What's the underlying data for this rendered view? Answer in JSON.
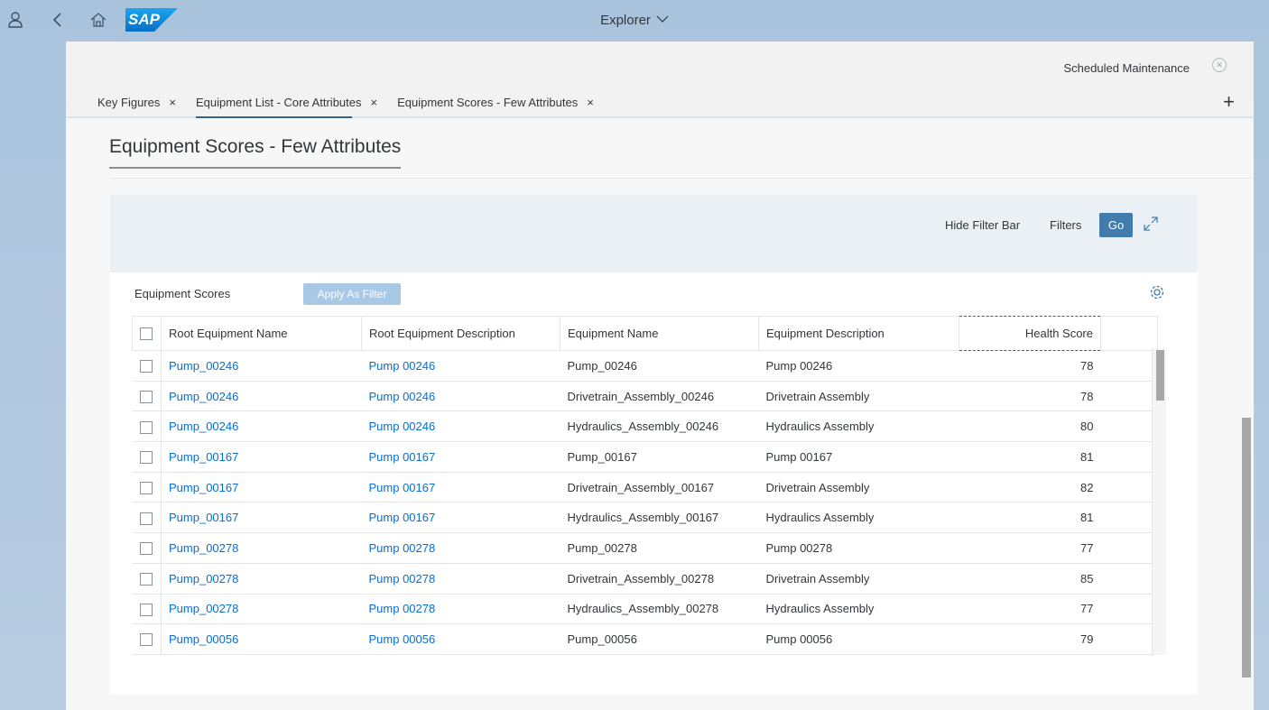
{
  "shell": {
    "title": "Explorer",
    "logo_text": "SAP"
  },
  "app_header": {
    "scheduled_link": "Scheduled Maintenance",
    "tabs": [
      {
        "label": "Key Figures",
        "close": "×"
      },
      {
        "label": "Equipment List - Core Attributes",
        "close": "×"
      },
      {
        "label": "Equipment Scores - Few Attributes",
        "close": "×"
      }
    ],
    "add_tab": "+"
  },
  "page": {
    "title": "Equipment Scores - Few Attributes"
  },
  "filter_bar": {
    "hide_label": "Hide Filter Bar",
    "filters_label": "Filters",
    "go_label": "Go"
  },
  "table": {
    "title": "Equipment Scores",
    "apply_label": "Apply As Filter",
    "columns": [
      "Root Equipment Name",
      "Root Equipment Description",
      "Equipment Name",
      "Equipment Description",
      "Health Score"
    ],
    "rows": [
      [
        "Pump_00246",
        "Pump 00246",
        "Pump_00246",
        "Pump 00246",
        "78"
      ],
      [
        "Pump_00246",
        "Pump 00246",
        "Drivetrain_Assembly_00246",
        "Drivetrain Assembly",
        "78"
      ],
      [
        "Pump_00246",
        "Pump 00246",
        "Hydraulics_Assembly_00246",
        "Hydraulics Assembly",
        "80"
      ],
      [
        "Pump_00167",
        "Pump 00167",
        "Pump_00167",
        "Pump 00167",
        "81"
      ],
      [
        "Pump_00167",
        "Pump 00167",
        "Drivetrain_Assembly_00167",
        "Drivetrain Assembly",
        "82"
      ],
      [
        "Pump_00167",
        "Pump 00167",
        "Hydraulics_Assembly_00167",
        "Hydraulics Assembly",
        "81"
      ],
      [
        "Pump_00278",
        "Pump 00278",
        "Pump_00278",
        "Pump 00278",
        "77"
      ],
      [
        "Pump_00278",
        "Pump 00278",
        "Drivetrain_Assembly_00278",
        "Drivetrain Assembly",
        "85"
      ],
      [
        "Pump_00278",
        "Pump 00278",
        "Hydraulics_Assembly_00278",
        "Hydraulics Assembly",
        "77"
      ],
      [
        "Pump_00056",
        "Pump 00056",
        "Pump_00056",
        "Pump 00056",
        "79"
      ]
    ]
  },
  "colors": {
    "link": "#0a6ed1",
    "go_button": "#427cac",
    "apply_button": "#a9c8e6",
    "shell_bg": "#b0c8e0"
  },
  "icons": [
    "user-icon",
    "back-icon",
    "home-icon",
    "sap-logo",
    "chevron-down-icon",
    "close-circle-icon",
    "add-icon",
    "expand-icon",
    "settings-icon",
    "checkbox-icon"
  ]
}
